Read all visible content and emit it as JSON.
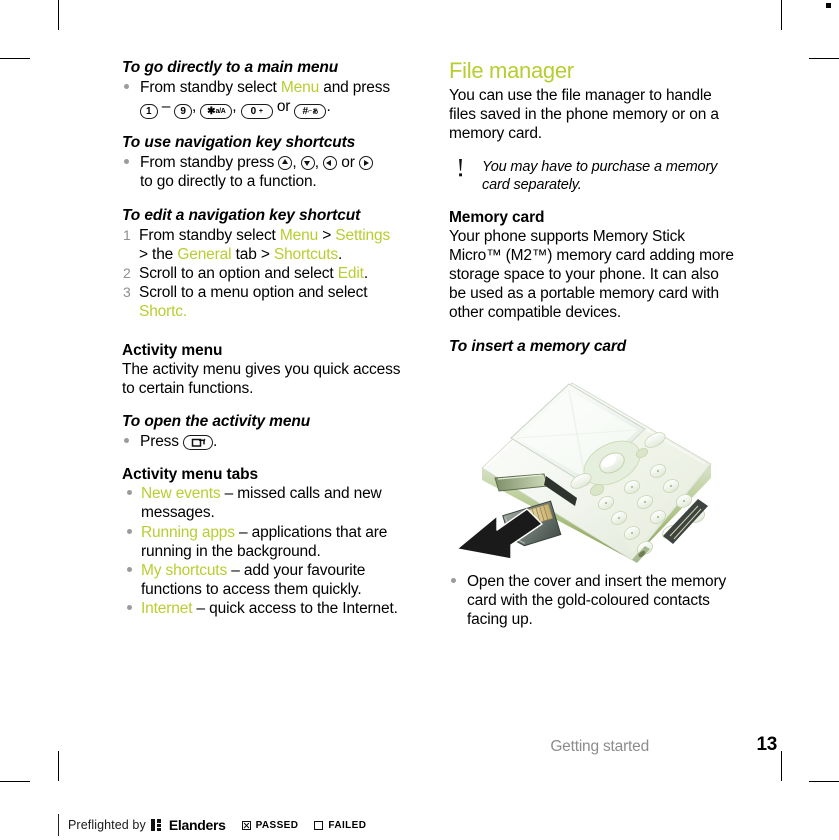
{
  "meta": {
    "section_footer": "Getting started",
    "page_number": "13",
    "accent_green": "#b9cd31",
    "body_black": "#000000",
    "footer_gray": "#8c8c8c"
  },
  "left_column": {
    "task1": {
      "heading": "To go directly to a main menu",
      "bullet_pre": "From standby select ",
      "bullet_menu": "Menu",
      "bullet_mid": " and press",
      "keys": {
        "k1": "1",
        "dash": "–",
        "k9": "9",
        "comma1": ",",
        "kstar_main": "✱",
        "kstar_sup": "a/A",
        "comma2": ",",
        "k0_main": "0",
        "k0_sup": "+",
        "or": "or",
        "khash_main": "#",
        "khash_sup": "⌐ぁ",
        "period": "."
      }
    },
    "task2": {
      "heading": "To use navigation key shortcuts",
      "bullet_pre": "From standby press ",
      "nav_sep1": ", ",
      "nav_sep2": ", ",
      "nav_or": " or ",
      "bullet_post": "to go directly to a function."
    },
    "task3": {
      "heading": "To edit a navigation key shortcut",
      "steps": [
        {
          "num": "1",
          "pre": "From standby select ",
          "menu": "Menu",
          "mid1": " > ",
          "settings": "Settings",
          "line2_pre": "> the ",
          "general": "General",
          "mid2": " tab > ",
          "shortcuts": "Shortcuts",
          "end": "."
        },
        {
          "num": "2",
          "pre": "Scroll to an option and select ",
          "edit": "Edit",
          "end": "."
        },
        {
          "num": "3",
          "pre": "Scroll to a menu option and select",
          "shortc": "Shortc.",
          "end": ""
        }
      ]
    },
    "activity": {
      "heading": "Activity menu",
      "body": "The activity menu gives you quick access to certain functions.",
      "open_heading": "To open the activity menu",
      "open_pre": "Press ",
      "open_post": ".",
      "tabs_heading": "Activity menu tabs",
      "tabs": [
        {
          "term": "New events",
          "desc": " – missed calls and new messages."
        },
        {
          "term": "Running apps",
          "desc": " – applications that are running in the background."
        },
        {
          "term": "My shortcuts",
          "desc": " – add your favourite functions to access them quickly."
        },
        {
          "term": "Internet",
          "desc": " – quick access to the Internet."
        }
      ]
    }
  },
  "right_column": {
    "file_manager": {
      "heading": "File manager",
      "body": "You can use the file manager to handle files saved in the phone memory or on a memory card."
    },
    "note": {
      "icon": "exclamation-icon",
      "text": "You may have to purchase a memory card separately."
    },
    "memory_card": {
      "heading": "Memory card",
      "body": "Your phone supports Memory Stick Micro™ (M2™) memory card adding more storage space to your phone. It can also be used as a portable memory card with other compatible devices."
    },
    "insert": {
      "heading": "To insert a memory card",
      "illustration_alt": "phone-memory-card-insertion-illustration",
      "bullet": "Open the cover and insert the memory card with the gold-coloured contacts facing up."
    }
  },
  "preflight": {
    "label": "Preflighted by",
    "brand": "Elanders",
    "passed": "PASSED",
    "failed": "FAILED"
  }
}
